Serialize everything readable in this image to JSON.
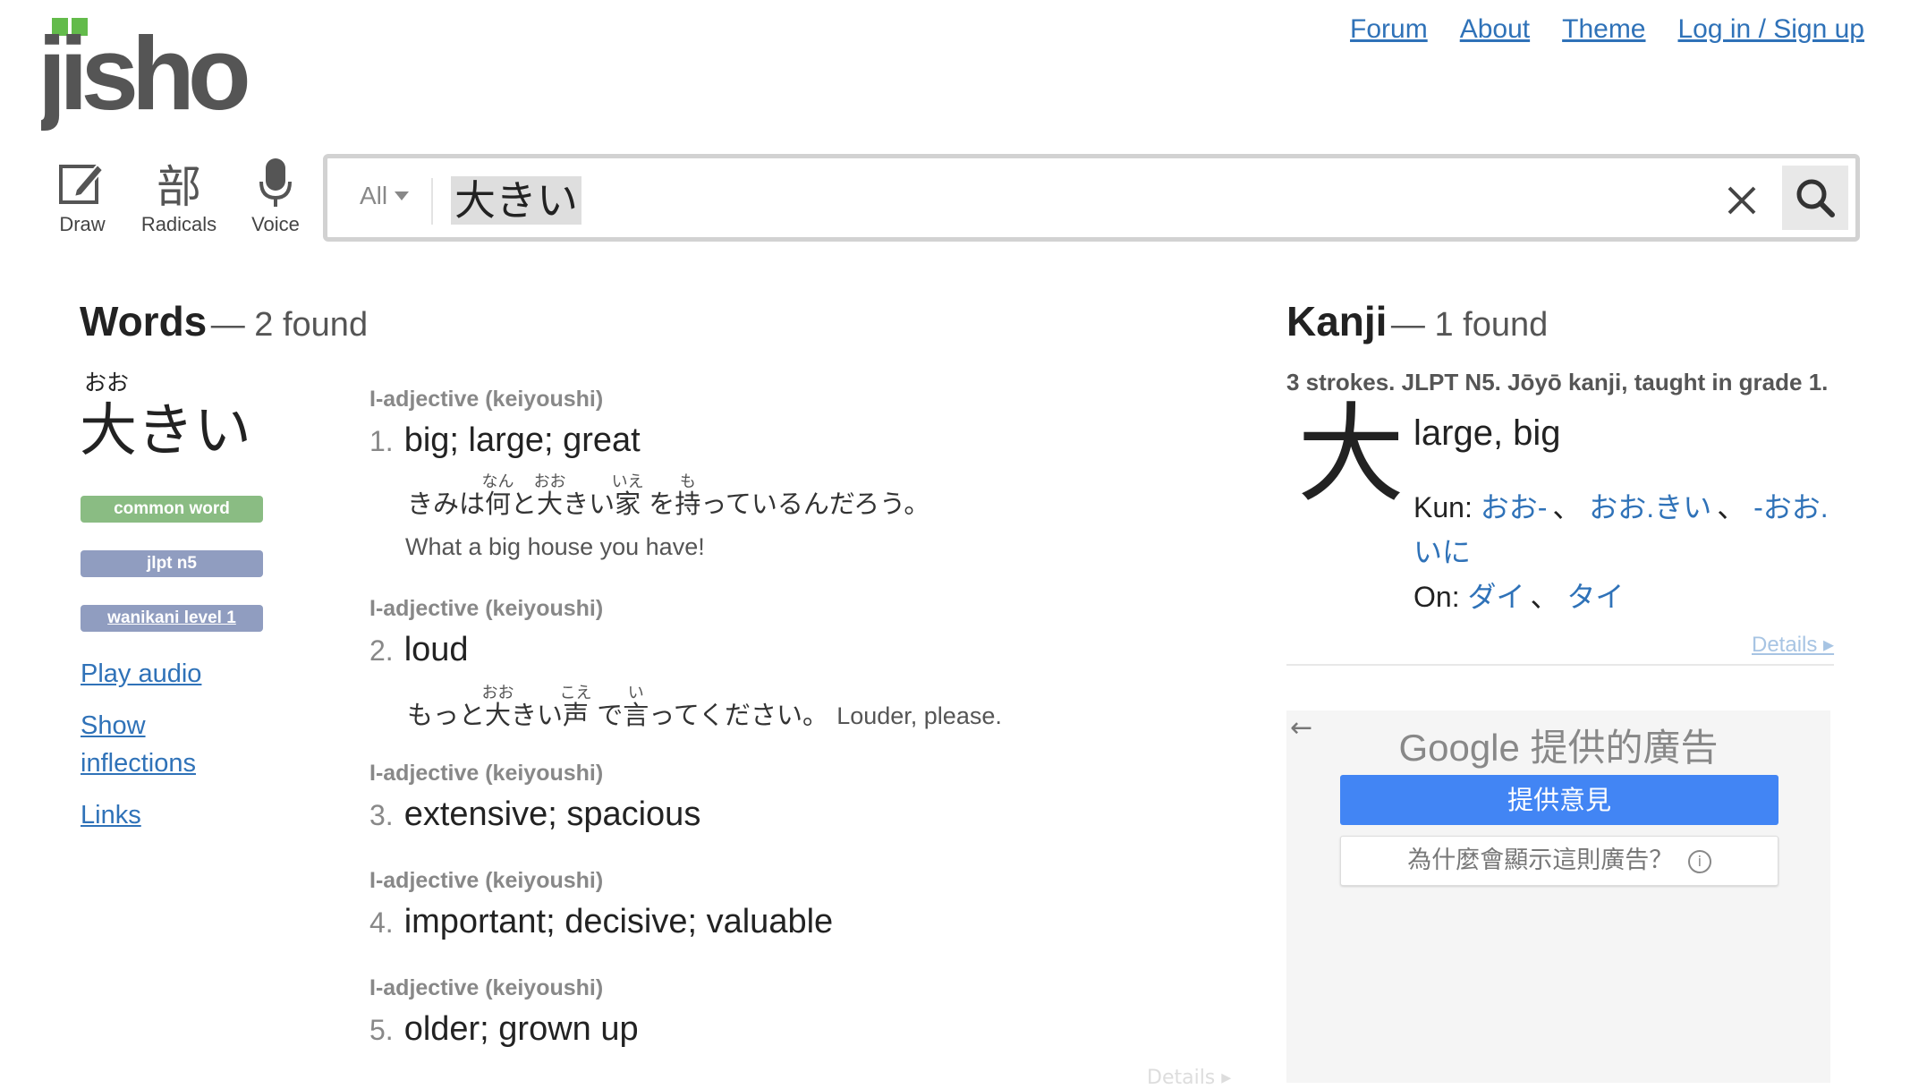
{
  "header": {
    "logo_text": "jisho",
    "links": {
      "forum": "Forum",
      "about": "About",
      "theme": "Theme",
      "login": "Log in / Sign up"
    },
    "tools": {
      "draw": "Draw",
      "radicals": "Radicals",
      "radicals_glyph": "部",
      "voice": "Voice"
    }
  },
  "search": {
    "scope": "All",
    "query": "大きい",
    "clear_icon": "close-icon",
    "search_icon": "search-icon"
  },
  "words": {
    "title": "Words",
    "count": "— 2 found",
    "entry": {
      "furigana": "おお",
      "word": "大きい",
      "tags": {
        "common": "common word",
        "jlpt": "jlpt n5",
        "wanikani": "wanikani level 1"
      },
      "links": {
        "play_audio": "Play audio",
        "show": "Show",
        "inflections": "inflections",
        "links": "Links"
      }
    },
    "meanings": [
      {
        "tags": "I-adjective (keiyoushi)",
        "num": "1.",
        "text": "big; large; great"
      },
      {
        "tags": "I-adjective (keiyoushi)",
        "num": "2.",
        "text": "loud"
      },
      {
        "tags": "I-adjective (keiyoushi)",
        "num": "3.",
        "text": "extensive; spacious"
      },
      {
        "tags": "I-adjective (keiyoushi)",
        "num": "4.",
        "text": "important; decisive; valuable"
      },
      {
        "tags": "I-adjective (keiyoushi)",
        "num": "5.",
        "text": "older; grown up"
      }
    ],
    "sentence1": {
      "p1": "きみは",
      "k1": "何",
      "r1": "なん",
      "p2": "と",
      "k2": "大",
      "r2": "おお",
      "p3": "きい",
      "k3": "家",
      "r3": "いえ",
      "p4": " を",
      "k4": "持",
      "r4": "も",
      "p5": "っているんだろう。",
      "english": "What a big house you have!"
    },
    "sentence2": {
      "p1": "もっと",
      "k1": "大",
      "r1": "おお",
      "p2": "きい",
      "k2": "声",
      "r2": "こえ",
      "p3": " で",
      "k3": "言",
      "r3": "い",
      "p4": "ってください。",
      "english": "Louder, please."
    },
    "faded_details": "Details ▸"
  },
  "kanji": {
    "title": "Kanji",
    "count": "— 1 found",
    "meta": "3 strokes. JLPT N5. Jōyō kanji, taught in grade 1.",
    "char": "大",
    "meaning": "large, big",
    "kun_label": "Kun: ",
    "kun": [
      "おお-",
      "おお.きい",
      "-おお.",
      "いに"
    ],
    "on_label": "On: ",
    "on": [
      "ダイ",
      "タイ"
    ],
    "separator": "、",
    "details": "Details ▸"
  },
  "ad": {
    "back_icon": "back-arrow-icon",
    "google": "Google 提供的廣告",
    "feedback": "提供意見",
    "why": "為什麼會顯示這則廣告？",
    "info_icon": "info-icon"
  },
  "colors": {
    "link": "#2f72b8",
    "logo_green": "#63bb4b",
    "logo_gray": "#555555",
    "tag_common": "#8abc83",
    "tag_jlpt": "#909dc0",
    "ad_button": "#4285f4"
  }
}
